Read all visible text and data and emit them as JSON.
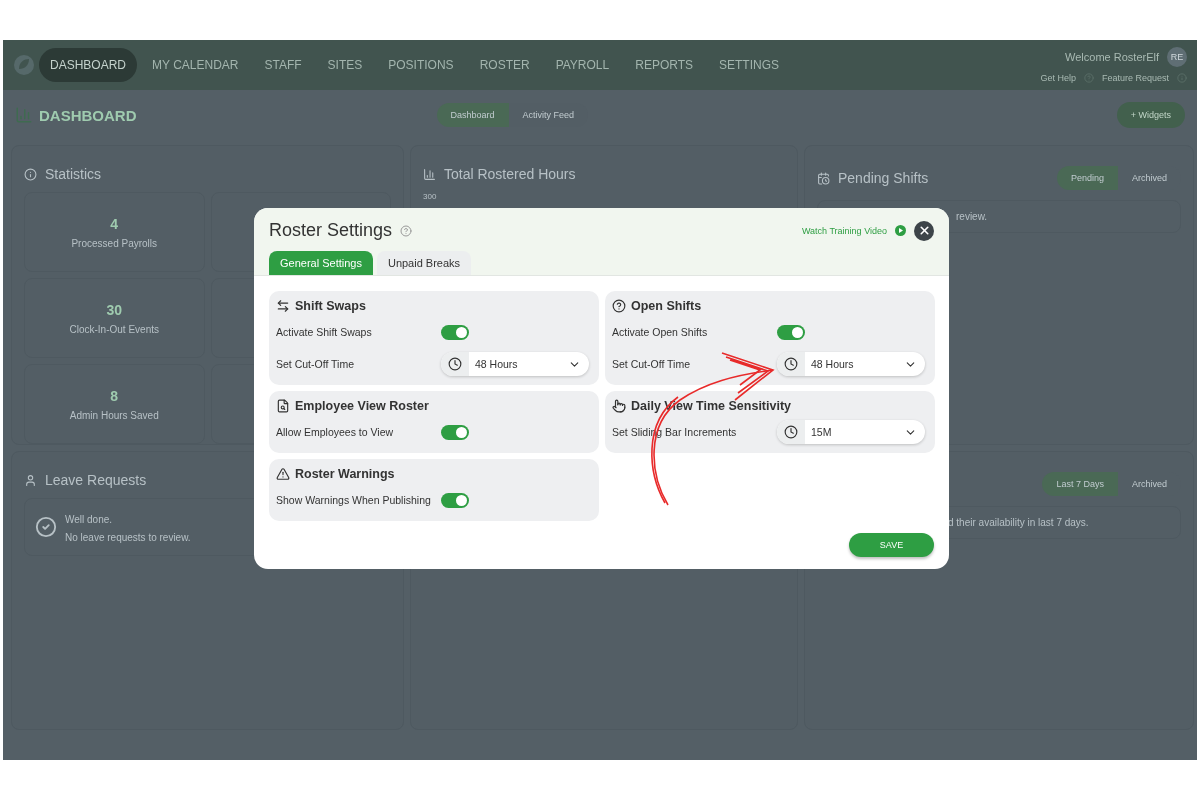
{
  "nav": {
    "items": [
      {
        "label": "DASHBOARD",
        "selected": true
      },
      {
        "label": "MY CALENDAR",
        "selected": false
      },
      {
        "label": "STAFF",
        "selected": false
      },
      {
        "label": "SITES",
        "selected": false
      },
      {
        "label": "POSITIONS",
        "selected": false
      },
      {
        "label": "ROSTER",
        "selected": false
      },
      {
        "label": "PAYROLL",
        "selected": false
      },
      {
        "label": "REPORTS",
        "selected": false
      },
      {
        "label": "SETTINGS",
        "selected": false
      }
    ],
    "welcome": "Welcome RosterElf",
    "avatar": "RE",
    "help_links": [
      "Get Help",
      "Feature Request"
    ]
  },
  "dashboard": {
    "title": "DASHBOARD",
    "tabs": [
      {
        "label": "Dashboard",
        "selected": true
      },
      {
        "label": "Activity Feed",
        "selected": false
      }
    ],
    "add_button": "+ Widgets"
  },
  "statistics": {
    "title": "Statistics",
    "stats": [
      {
        "value": "4",
        "label": "Processed Payrolls"
      },
      {
        "value": "30",
        "label": "Clock-In-Out Events"
      },
      {
        "value": "8",
        "label": "Admin Hours Saved"
      }
    ]
  },
  "leave_requests": {
    "title": "Leave Requests",
    "message": "Well done.",
    "detail": "No leave requests to review."
  },
  "rostered_hours": {
    "title": "Total Rostered Hours",
    "tick": "300"
  },
  "pending_shifts": {
    "title": "Pending Shifts",
    "tabs": [
      {
        "label": "Pending",
        "selected": true
      },
      {
        "label": "Archived",
        "selected": false
      }
    ],
    "text": "review."
  },
  "availability": {
    "tabs": [
      {
        "label": "Last 7 Days",
        "selected": true
      },
      {
        "label": "Archived",
        "selected": false
      }
    ],
    "text": "d their availability in last 7 days."
  },
  "modal": {
    "title": "Roster Settings",
    "video_link": "Watch Training Video",
    "tabs": [
      {
        "label": "General Settings",
        "selected": true
      },
      {
        "label": "Unpaid Breaks",
        "selected": false
      }
    ],
    "columns": [
      [
        {
          "title": "Shift Swaps",
          "rows": [
            {
              "kind": "toggle",
              "label": "Activate Shift Swaps",
              "on": true
            },
            {
              "kind": "select",
              "label": "Set Cut-Off Time",
              "value": "48 Hours"
            }
          ]
        },
        {
          "title": "Employee View Roster",
          "rows": [
            {
              "kind": "toggle",
              "label": "Allow Employees to View",
              "on": true
            }
          ]
        },
        {
          "title": "Roster Warnings",
          "rows": [
            {
              "kind": "toggle",
              "label": "Show Warnings When Publishing",
              "on": true
            }
          ]
        }
      ],
      [
        {
          "title": "Open Shifts",
          "rows": [
            {
              "kind": "toggle",
              "label": "Activate Open Shifts",
              "on": true
            },
            {
              "kind": "select",
              "label": "Set Cut-Off Time",
              "value": "48 Hours"
            }
          ]
        },
        {
          "title": "Daily View Time Sensitivity",
          "rows": [
            {
              "kind": "select",
              "label": "Set Sliding Bar Increments",
              "value": "15M"
            }
          ]
        }
      ]
    ],
    "save_button": "SAVE"
  }
}
